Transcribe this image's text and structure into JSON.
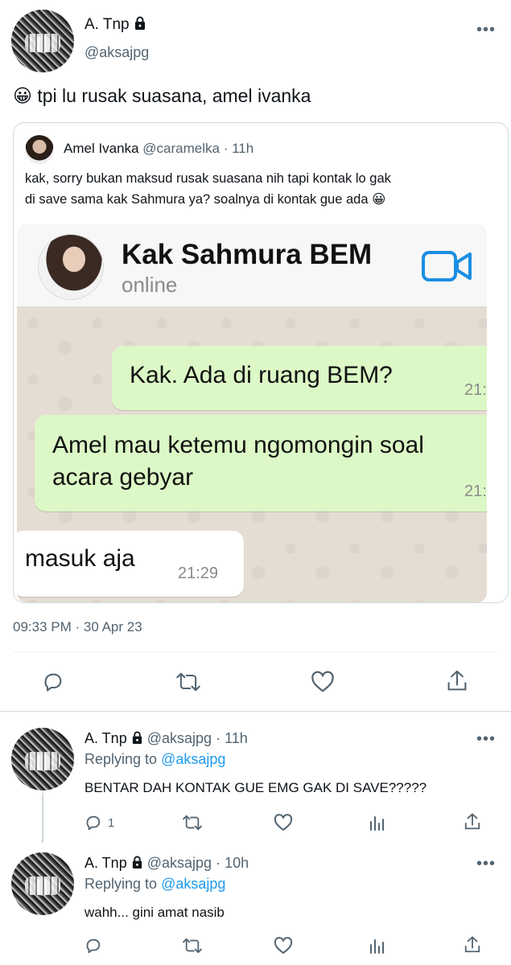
{
  "main_tweet": {
    "author_name": "A. Tnp",
    "author_handle": "@aksajpg",
    "more_label": "•••",
    "emoji": "😀",
    "text": "tpi lu rusak suasana, amel ivanka",
    "timestamp": "09:33 PM · 30 Apr 23"
  },
  "quote": {
    "author_name": "Amel Ivanka",
    "author_handle": "@caramelka",
    "time": "· 11h",
    "text_line1": "kak, sorry bukan maksud rusak suasana nih tapi kontak lo gak",
    "text_line2": "di save sama kak Sahmura ya? soalnya di kontak gue ada 😀",
    "chat": {
      "contact_name": "Kak Sahmura BEM",
      "status": "online",
      "messages": [
        {
          "text": "Kak. Ada di ruang BEM?",
          "time": "21:",
          "direction": "out"
        },
        {
          "text_line1": "Amel mau ketemu ngomongin soal",
          "text_line2": "acara gebyar",
          "time": "21:",
          "direction": "out"
        },
        {
          "text": "masuk aja",
          "time": "21:29",
          "direction": "in"
        }
      ]
    }
  },
  "actions": {
    "reply": "reply-icon",
    "retweet": "retweet-icon",
    "like": "heart-icon",
    "share": "share-icon"
  },
  "replies": [
    {
      "author_name": "A. Tnp",
      "author_handle": "@aksajpg",
      "time": "· 11h",
      "replying_prefix": "Replying to",
      "replying_to": "@aksajpg",
      "text": "BENTAR DAH KONTAK GUE EMG GAK DI SAVE?????",
      "reply_count": "1",
      "more_label": "•••"
    },
    {
      "author_name": "A. Tnp",
      "author_handle": "@aksajpg",
      "time": "· 10h",
      "replying_prefix": "Replying to",
      "replying_to": "@aksajpg",
      "text": "wahh... gini amat nasib",
      "reply_count": "",
      "more_label": "•••"
    }
  ],
  "colors": {
    "accent": "#1d9bf0",
    "muted": "#536471",
    "whatsapp_bubble_out": "#dcf8c6",
    "video_icon": "#1a8fe3"
  }
}
